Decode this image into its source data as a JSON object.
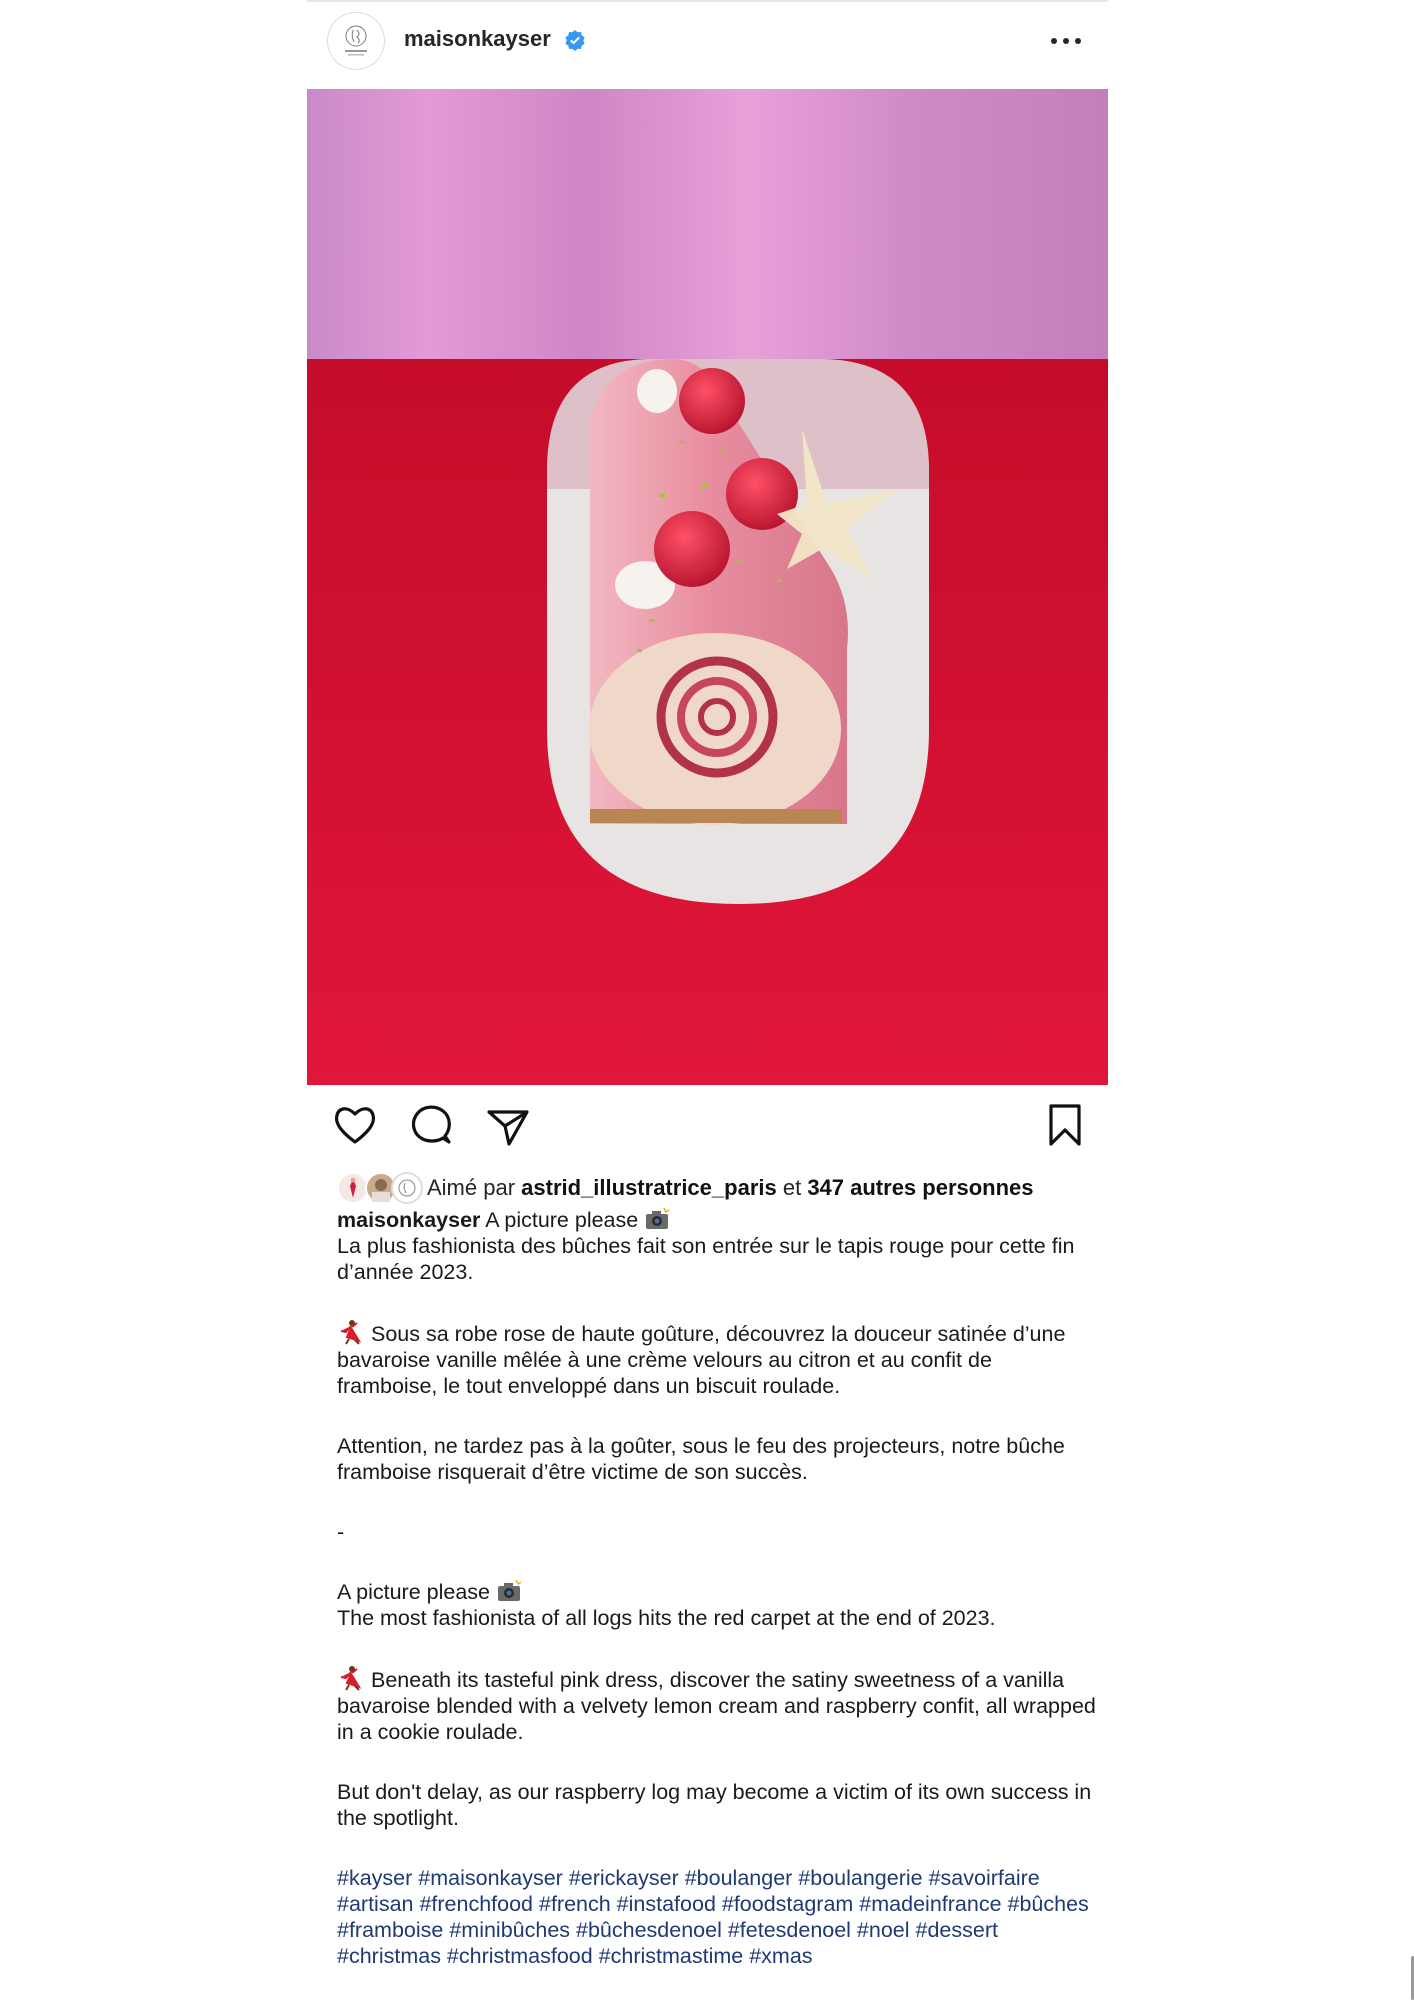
{
  "header": {
    "username": "maisonkayser",
    "avatar_icon": "eric-kayser-logo-icon",
    "verified_icon": "verified-badge-icon",
    "more_icon": "more-options-icon"
  },
  "photo": {
    "colors": {
      "backdrop": "#d98ad0",
      "table": "#d0102e",
      "plate": "#ece8e8",
      "log": "#e98ea0"
    }
  },
  "actions": {
    "like_icon": "heart-icon",
    "comment_icon": "comment-icon",
    "share_icon": "send-icon",
    "save_icon": "bookmark-icon"
  },
  "likes": {
    "prefix": "Aimé par ",
    "user": "astrid_illustratrice_paris",
    "middle": " et ",
    "count_text": "347 autres personnes"
  },
  "caption": {
    "username": "maisonkayser",
    "title_fr": "A picture please",
    "p1_fr": "La plus fashionista des bûches fait son entrée sur le tapis rouge pour cette fin d’année 2023.",
    "p2_fr": "Sous sa robe rose de haute goûture, découvrez la douceur satinée d’une bavaroise vanille mêlée à une crème velours au citron et au confit de framboise, le tout enveloppé dans un biscuit roulade.",
    "p3_fr": "Attention, ne tardez pas à la goûter, sous le feu des projecteurs, notre bûche framboise risquerait d’être victime de son succès.",
    "separator": "-",
    "title_en": "A picture please",
    "p1_en": "The most fashionista of all logs hits the red carpet at the end of 2023.",
    "p2_en": "Beneath its tasteful pink dress, discover the satiny sweetness of a vanilla bavaroise blended with a velvety lemon cream and raspberry confit, all wrapped in a cookie roulade.",
    "p3_en": "But don't delay, as our raspberry log may become a victim of its own success in the spotlight.",
    "hashtags": "#kayser #maisonkayser #erickayser #boulanger #boulangerie #savoirfaire #artisan #frenchfood #french #instafood #foodstagram #madeinfrance #bûches #framboise #minibûches #bûchesdenoel #fetesdenoel #noel #dessert #christmas #christmasfood #christmastime #xmas",
    "camera_icon": "camera-flash-icon",
    "dancer_icon": "dancer-icon"
  },
  "colors": {
    "hashtag": "#1f3a73",
    "verified": "#3897f0",
    "text": "#1a1a1a"
  }
}
